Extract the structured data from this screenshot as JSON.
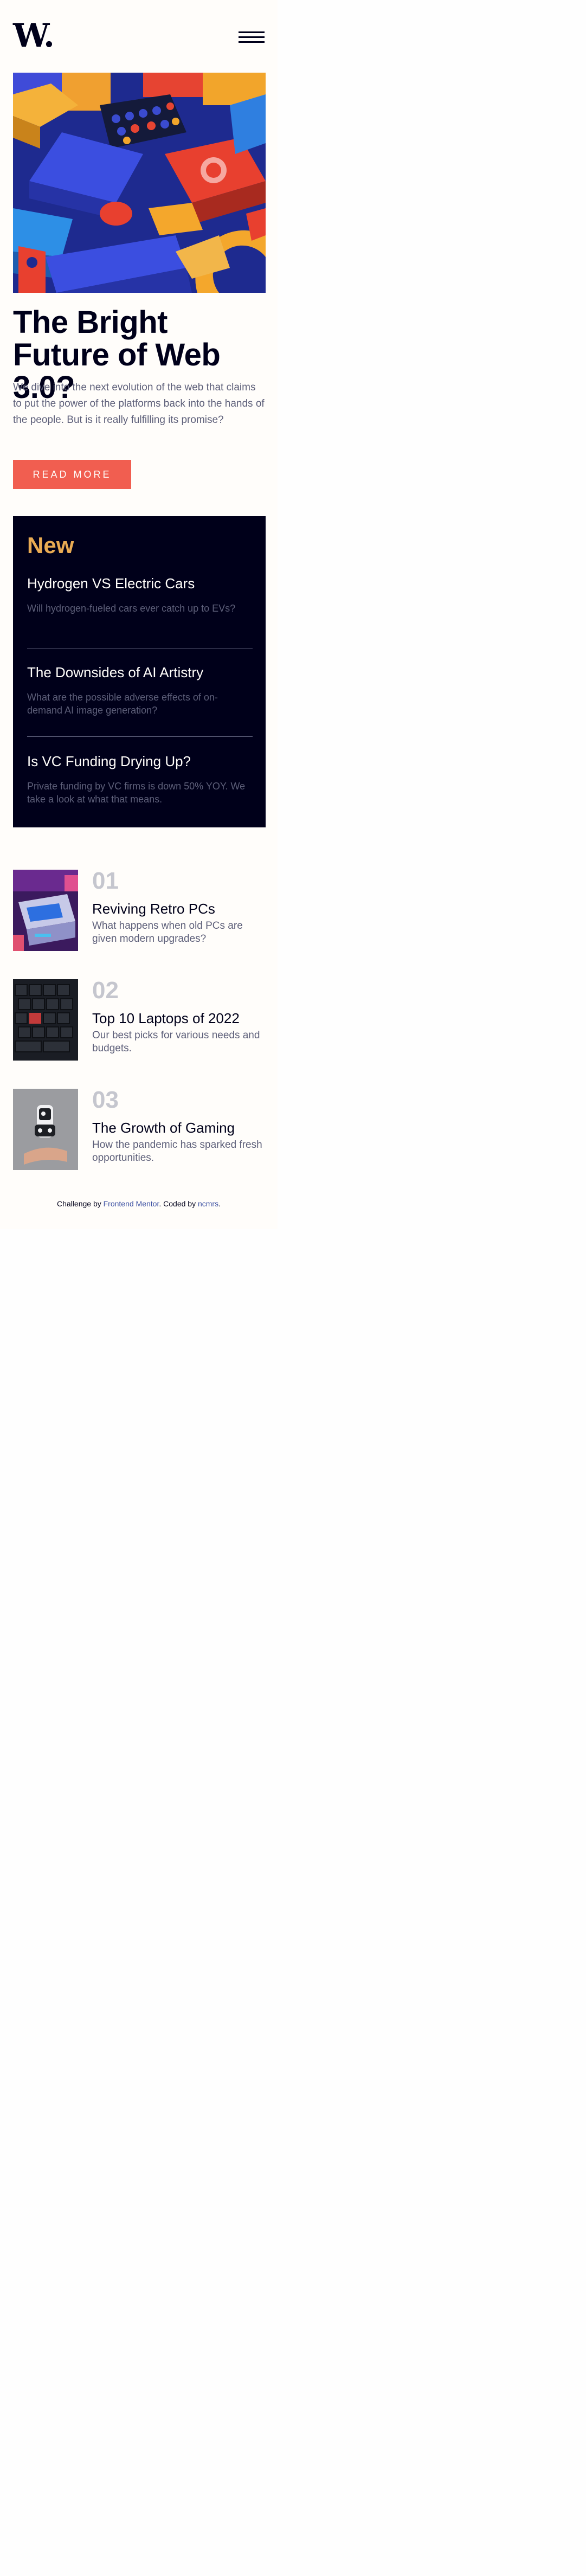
{
  "brand": {
    "logo_text": "W."
  },
  "nav": {
    "menu_icon": "hamburger-menu-icon"
  },
  "hero": {
    "image_alt": "abstract colorful 3D blocks",
    "title": "The Bright Future of Web 3.0?",
    "description": "We dive into the next evolution of the web that claims to put the power of the platforms back into the hands of the people. But is it really fulfilling its promise?",
    "button_label": "Read more"
  },
  "new_section": {
    "heading": "New",
    "items": [
      {
        "title": "Hydrogen VS Electric Cars",
        "description": "Will hydrogen-fueled cars ever catch up to EVs?"
      },
      {
        "title": "The Downsides of AI Artistry",
        "description": "What are the possible adverse effects of on-demand AI image generation?"
      },
      {
        "title": "Is VC Funding Drying Up?",
        "description": "Private funding by VC firms is down 50% YOY. We take a look at what that means."
      }
    ]
  },
  "articles": [
    {
      "number": "01",
      "title": "Reviving Retro PCs",
      "description": "What happens when old PCs are given modern upgrades?"
    },
    {
      "number": "02",
      "title": "Top 10 Laptops of 2022",
      "description": "Our best picks for various needs and budgets."
    },
    {
      "number": "03",
      "title": "The Growth of Gaming",
      "description": "How the pandemic has sparked fresh opportunities."
    }
  ],
  "footer": {
    "prefix": "Challenge by ",
    "fm_link": "Frontend Mentor",
    "middle": ". Coded by ",
    "author_link": "ncmrs",
    "suffix": "."
  },
  "colors": {
    "accent": "#f15e50",
    "dark": "#00001a",
    "gold": "#e9ab53",
    "muted": "#5d5f79",
    "background": "#fffdfa"
  }
}
